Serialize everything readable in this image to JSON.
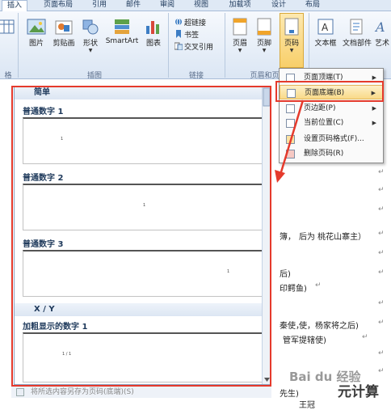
{
  "tabs": [
    "插入",
    "页面布局",
    "引用",
    "邮件",
    "审阅",
    "视图",
    "加载项",
    "设计",
    "布局"
  ],
  "ribbon": {
    "left_group_label": "格",
    "illustrations": {
      "buttons": [
        "图片",
        "剪贴画",
        "形状",
        "SmartArt",
        "图表"
      ],
      "group_label": "插图"
    },
    "links": {
      "items": [
        "超链接",
        "书签",
        "交叉引用"
      ],
      "group_label": "链接"
    },
    "header_footer": {
      "buttons": [
        "页眉",
        "页脚",
        "页码"
      ],
      "group_label": "页眉和页脚"
    },
    "text": {
      "buttons": [
        "文本框",
        "文档部件",
        "艺术"
      ]
    }
  },
  "page_number_menu": {
    "items": [
      {
        "label": "页面顶端(T)",
        "submenu": true
      },
      {
        "label": "页面底端(B)",
        "submenu": true,
        "highlighted": true
      },
      {
        "label": "页边距(P)",
        "submenu": true
      },
      {
        "label": "当前位置(C)",
        "submenu": true
      },
      {
        "label": "设置页码格式(F)...",
        "submenu": false
      },
      {
        "label": "删除页码(R)",
        "submenu": false
      }
    ]
  },
  "gallery": {
    "section_title": "简单",
    "items": [
      {
        "label": "普通数字 1",
        "num": "1"
      },
      {
        "label": "普通数字 2",
        "num": "1"
      },
      {
        "label": "普通数字 3",
        "num": "1"
      }
    ],
    "section_title_2": "X / Y",
    "items_2": [
      {
        "label": "加粗显示的数字 1",
        "num": "1 / 1"
      }
    ],
    "footer": "将所选内容另存为页码(底端)(S)"
  },
  "document": {
    "lines": [
      "后为 桃花山寨主）",
      "后)",
      "印鳄鱼)",
      "使，杨家将之后)",
      "管军提辖使)",
      "先生)",
      "王冠"
    ],
    "fragments": [
      "簿，",
      "秦使，"
    ]
  },
  "watermark": {
    "text": "Bai du 经验",
    "brand": "元计算"
  },
  "colors": {
    "highlight": "#f9da88",
    "annotation": "#e53a2c"
  }
}
